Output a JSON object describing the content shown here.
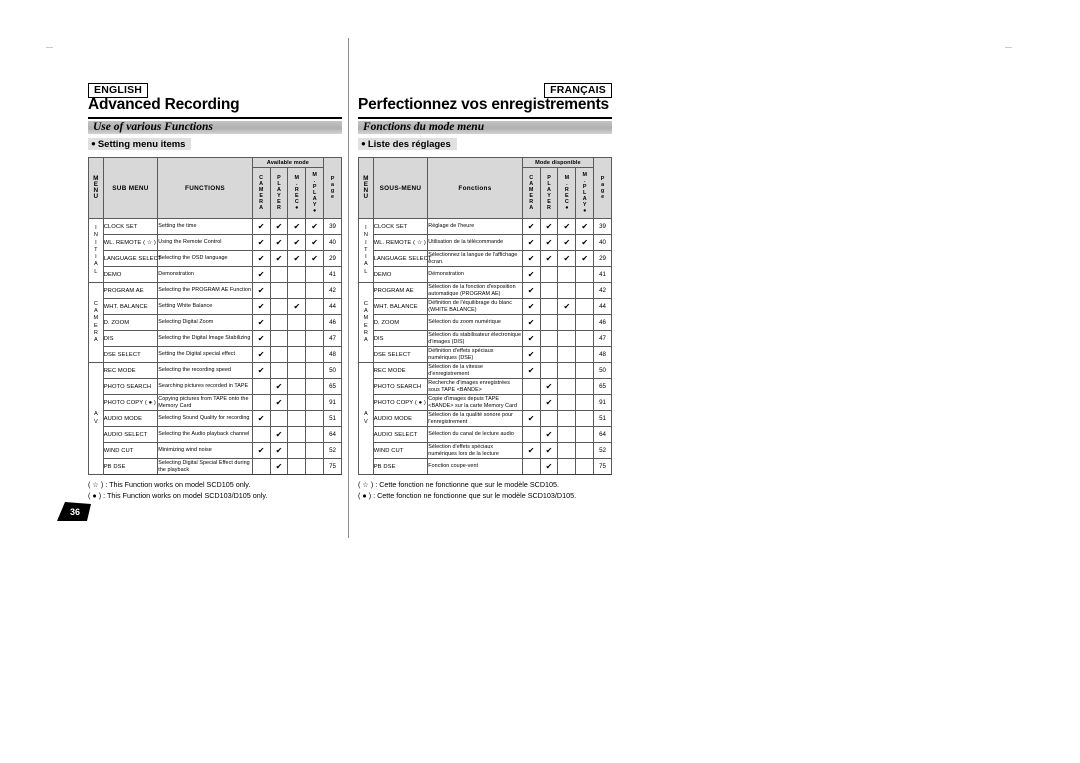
{
  "page_number": "36",
  "columns": [
    {
      "id": "english",
      "lang_badge": "ENGLISH",
      "chapter_title": "Advanced Recording",
      "section_bar": "Use of various Functions",
      "subsection": "Setting menu items",
      "table": {
        "available_mode_header": "Available mode",
        "headers": {
          "menu": [
            "M",
            "E",
            "N",
            "U"
          ],
          "sub_menu": "SUB MENU",
          "functions": "FUNCTIONS",
          "mode_camera": [
            "C",
            "A",
            "M",
            "E",
            "R",
            "A"
          ],
          "mode_player": [
            "P",
            "L",
            "A",
            "Y",
            "E",
            "R"
          ],
          "mode_mrec": [
            "M",
            ".",
            "R",
            "E",
            "C",
            "●"
          ],
          "mode_mplay": [
            "M",
            ".",
            "P",
            "L",
            "A",
            "Y",
            "●"
          ],
          "page": [
            "P",
            "a",
            "g",
            "e"
          ]
        },
        "groups": [
          {
            "label": [
              "I",
              "N",
              "I",
              "T",
              "I",
              "A",
              "L"
            ],
            "rows": [
              {
                "sub": "CLOCK SET",
                "func": "Setting the time",
                "modes": [
                  true,
                  true,
                  true,
                  true
                ],
                "page": "39"
              },
              {
                "sub": "WL. REMOTE ( ☆ )",
                "func": "Using the Remote Control",
                "modes": [
                  true,
                  true,
                  true,
                  true
                ],
                "page": "40"
              },
              {
                "sub": "LANGUAGE SELECT",
                "func": "Selecting the OSD language",
                "modes": [
                  true,
                  true,
                  true,
                  true
                ],
                "page": "29"
              },
              {
                "sub": "DEMO",
                "func": "Demonstration",
                "modes": [
                  true,
                  false,
                  false,
                  false
                ],
                "page": "41"
              }
            ]
          },
          {
            "label": [
              "C",
              "A",
              "M",
              "E",
              "R",
              "A"
            ],
            "rows": [
              {
                "sub": "PROGRAM AE",
                "func": "Selecting the PROGRAM AE Function",
                "modes": [
                  true,
                  false,
                  false,
                  false
                ],
                "page": "42"
              },
              {
                "sub": "WHT. BALANCE",
                "func": "Setting White Balance",
                "modes": [
                  true,
                  false,
                  true,
                  false
                ],
                "page": "44"
              },
              {
                "sub": "D. ZOOM",
                "func": "Selecting Digital Zoom",
                "modes": [
                  true,
                  false,
                  false,
                  false
                ],
                "page": "46"
              },
              {
                "sub": "DIS",
                "func": "Selecting the Digital Image Stabilizing",
                "modes": [
                  true,
                  false,
                  false,
                  false
                ],
                "page": "47"
              },
              {
                "sub": "DSE SELECT",
                "func": "Setting the Digital special effect",
                "modes": [
                  true,
                  false,
                  false,
                  false
                ],
                "page": "48"
              }
            ]
          },
          {
            "label": [
              "A",
              "V"
            ],
            "rows": [
              {
                "sub": "REC MODE",
                "func": "Selecting the recording speed",
                "modes": [
                  true,
                  false,
                  false,
                  false
                ],
                "page": "50"
              },
              {
                "sub": "PHOTO SEARCH",
                "func": "Searching pictures recorded in TAPE",
                "modes": [
                  false,
                  true,
                  false,
                  false
                ],
                "page": "65"
              },
              {
                "sub": "PHOTO COPY ( ● )",
                "func": "Copying pictures from TAPE onto the Memory Card",
                "modes": [
                  false,
                  true,
                  false,
                  false
                ],
                "page": "91"
              },
              {
                "sub": "AUDIO MODE",
                "func": "Selecting Sound Quality for recording",
                "modes": [
                  true,
                  false,
                  false,
                  false
                ],
                "page": "51"
              },
              {
                "sub": "AUDIO SELECT",
                "func": "Selecting the Audio playback channel",
                "modes": [
                  false,
                  true,
                  false,
                  false
                ],
                "page": "64"
              },
              {
                "sub": "WIND CUT",
                "func": "Minimizing wind noise",
                "modes": [
                  true,
                  true,
                  false,
                  false
                ],
                "page": "52"
              },
              {
                "sub": "PB DSE",
                "func": "Selecting Digital Special Effect during the playback",
                "modes": [
                  false,
                  true,
                  false,
                  false
                ],
                "page": "75"
              }
            ]
          }
        ]
      },
      "footnotes": [
        "( ☆ ) : This Function works on model SCD105 only.",
        "( ● ) : This Function works on model SCD103/D105 only."
      ]
    },
    {
      "id": "francais",
      "lang_badge": "FRANÇAIS",
      "chapter_title": "Perfectionnez vos enregistrements",
      "section_bar": "Fonctions du mode menu",
      "subsection": "Liste des réglages",
      "table": {
        "available_mode_header": "Mode disponible",
        "headers": {
          "menu": [
            "M",
            "E",
            "N",
            "U"
          ],
          "sub_menu": "SOUS-MENU",
          "functions": "Fonctions",
          "mode_camera": [
            "C",
            "A",
            "M",
            "E",
            "R",
            "A"
          ],
          "mode_player": [
            "P",
            "L",
            "A",
            "Y",
            "E",
            "R"
          ],
          "mode_mrec": [
            "M",
            ".",
            "R",
            "E",
            "C",
            "●"
          ],
          "mode_mplay": [
            "M",
            ".",
            "P",
            "L",
            "A",
            "Y",
            "●"
          ],
          "page": [
            "P",
            "a",
            "g",
            "e"
          ]
        },
        "groups": [
          {
            "label": [
              "I",
              "N",
              "I",
              "T",
              "I",
              "A",
              "L"
            ],
            "rows": [
              {
                "sub": "CLOCK SET",
                "func": "Réglage de l'heure",
                "modes": [
                  true,
                  true,
                  true,
                  true
                ],
                "page": "39"
              },
              {
                "sub": "WL. REMOTE ( ☆ )",
                "func": "Utilisation de la télécommande",
                "modes": [
                  true,
                  true,
                  true,
                  true
                ],
                "page": "40"
              },
              {
                "sub": "LANGUAGE SELECT",
                "func": "Sélectionnez la langue de l'affichage écran.",
                "modes": [
                  true,
                  true,
                  true,
                  true
                ],
                "page": "29"
              },
              {
                "sub": "DEMO",
                "func": "Démonstration",
                "modes": [
                  true,
                  false,
                  false,
                  false
                ],
                "page": "41"
              }
            ]
          },
          {
            "label": [
              "C",
              "A",
              "M",
              "E",
              "R",
              "A"
            ],
            "rows": [
              {
                "sub": "PROGRAM AE",
                "func": "Sélection de la fonction d'exposition automatique (PROGRAM AE)",
                "modes": [
                  true,
                  false,
                  false,
                  false
                ],
                "page": "42"
              },
              {
                "sub": "WHT. BALANCE",
                "func": "Définition de l'équilibrage du blanc (WHITE BALANCE)",
                "modes": [
                  true,
                  false,
                  true,
                  false
                ],
                "page": "44"
              },
              {
                "sub": "D. ZOOM",
                "func": "Sélection du zoom numérique",
                "modes": [
                  true,
                  false,
                  false,
                  false
                ],
                "page": "46"
              },
              {
                "sub": "DIS",
                "func": "Sélection du stabilisateur électronique d'images (DIS)",
                "modes": [
                  true,
                  false,
                  false,
                  false
                ],
                "page": "47"
              },
              {
                "sub": "DSE SELECT",
                "func": "Définition d'effets spéciaux numériques (DSE)",
                "modes": [
                  true,
                  false,
                  false,
                  false
                ],
                "page": "48"
              }
            ]
          },
          {
            "label": [
              "A",
              "V"
            ],
            "rows": [
              {
                "sub": "REC MODE",
                "func": "Sélection de la vitesse d'enregistrement",
                "modes": [
                  true,
                  false,
                  false,
                  false
                ],
                "page": "50"
              },
              {
                "sub": "PHOTO SEARCH",
                "func": "Recherche d'images enregistrées sous TAPE <BANDE>",
                "modes": [
                  false,
                  true,
                  false,
                  false
                ],
                "page": "65"
              },
              {
                "sub": "PHOTO COPY ( ● )",
                "func": "Copie d'images depuis TAPE <BANDE> sur la carte Memory Card",
                "modes": [
                  false,
                  true,
                  false,
                  false
                ],
                "page": "91"
              },
              {
                "sub": "AUDIO MODE",
                "func": "Sélection de la qualité sonore pour l'enregistrement",
                "modes": [
                  true,
                  false,
                  false,
                  false
                ],
                "page": "51"
              },
              {
                "sub": "AUDIO SELECT",
                "func": "Sélection du canal de lecture audio",
                "modes": [
                  false,
                  true,
                  false,
                  false
                ],
                "page": "64"
              },
              {
                "sub": "WIND CUT",
                "func": "Sélection d'effets spéciaux numériques lors de la lecture",
                "modes": [
                  true,
                  true,
                  false,
                  false
                ],
                "page": "52"
              },
              {
                "sub": "PB DSE",
                "func": "Fonction coupe-vent",
                "modes": [
                  false,
                  true,
                  false,
                  false
                ],
                "page": "75"
              }
            ]
          }
        ]
      },
      "footnotes": [
        "( ☆ ) : Cette fonction ne fonctionne que sur le modèle SCD105.",
        "( ● ) : Cette fonction ne fonctionne que sur le modèle SCD103/D105."
      ]
    }
  ]
}
